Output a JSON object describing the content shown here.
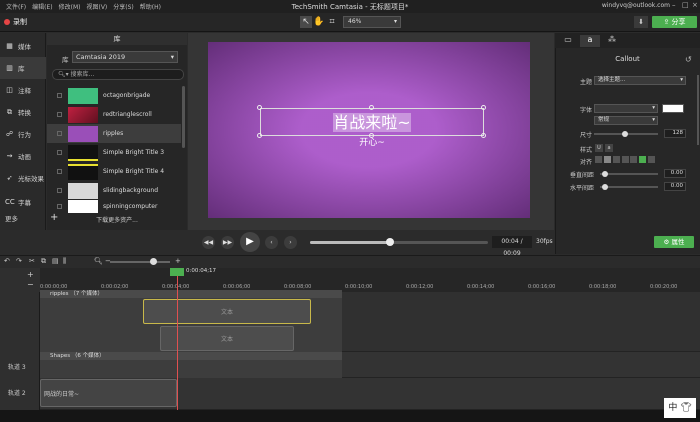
{
  "app_title": "TechSmith Camtasia - 无标题项目*",
  "menu": [
    "文件(F)",
    "编辑(E)",
    "修改(M)",
    "视图(V)",
    "分享(S)",
    "帮助(H)"
  ],
  "account": "windyvq@outlook.com",
  "toolbar": {
    "record": "录制",
    "zoom": "46%",
    "share": "分享"
  },
  "left_tabs": [
    {
      "icon": "media-icon",
      "label": "媒体"
    },
    {
      "icon": "library-icon",
      "label": "库"
    },
    {
      "icon": "annotation-icon",
      "label": "注释"
    },
    {
      "icon": "transition-icon",
      "label": "转换"
    },
    {
      "icon": "behavior-icon",
      "label": "行为"
    },
    {
      "icon": "animation-icon",
      "label": "动画"
    },
    {
      "icon": "cursor-effect-icon",
      "label": "光标效果"
    },
    {
      "icon": "caption-icon",
      "label": "字幕"
    }
  ],
  "more_tab": "更多",
  "library": {
    "header": "库",
    "select_label": "库",
    "selected_library": "Camtasia 2019",
    "search_placeholder": "搜索库...",
    "items": [
      {
        "name": "octagonbrigade",
        "thumb": "#3fbf7f"
      },
      {
        "name": "redtrianglescroll",
        "thumb": "#c02040"
      },
      {
        "name": "ripples",
        "thumb": "#9a4fb8"
      },
      {
        "name": "Simple Bright Title 3",
        "thumb": "#111111"
      },
      {
        "name": "Simple Bright Title 4",
        "thumb": "#111111"
      },
      {
        "name": "slidingbackground",
        "thumb": "#d8d8d8"
      },
      {
        "name": "spinningcomputer",
        "thumb": "#ffffff"
      }
    ],
    "more_assets": "下载更多资产..."
  },
  "canvas": {
    "callout_title": "肖战来啦~",
    "callout_sub": "开心~"
  },
  "transport": {
    "time": "00:04 / 00:09",
    "fps": "30fps",
    "progress": 0.45
  },
  "properties": {
    "title": "Callout",
    "theme_label": "主题",
    "theme_value": "选择主题...",
    "font_label": "字体",
    "style_value": "常规",
    "size_label": "尺寸",
    "size_value": "128",
    "style_label": "样式",
    "align_label": "对齐",
    "vspace_label": "垂直间距",
    "vspace_value": "0.00",
    "hspace_label": "水平间距",
    "hspace_value": "0.00",
    "props_button": "属性"
  },
  "timeline": {
    "playhead_time": "0:00:04;17",
    "ticks": [
      "0:00:00;00",
      "0:00:02;00",
      "0:00:04;00",
      "0:00:06;00",
      "0:00:08;00",
      "0:00:10;00",
      "0:00:12;00",
      "0:00:14;00",
      "0:00:16;00",
      "0:00:18;00",
      "0:00:20;00"
    ],
    "group1": "ripples （7 个媒体）",
    "clip_text_1": "文本",
    "clip_text_2": "文本",
    "group2": "Shapes （6 个媒体）",
    "track3": "轨道 3",
    "track2": "轨道 2",
    "track2_clip": "网战的日常~"
  },
  "ime": "中"
}
